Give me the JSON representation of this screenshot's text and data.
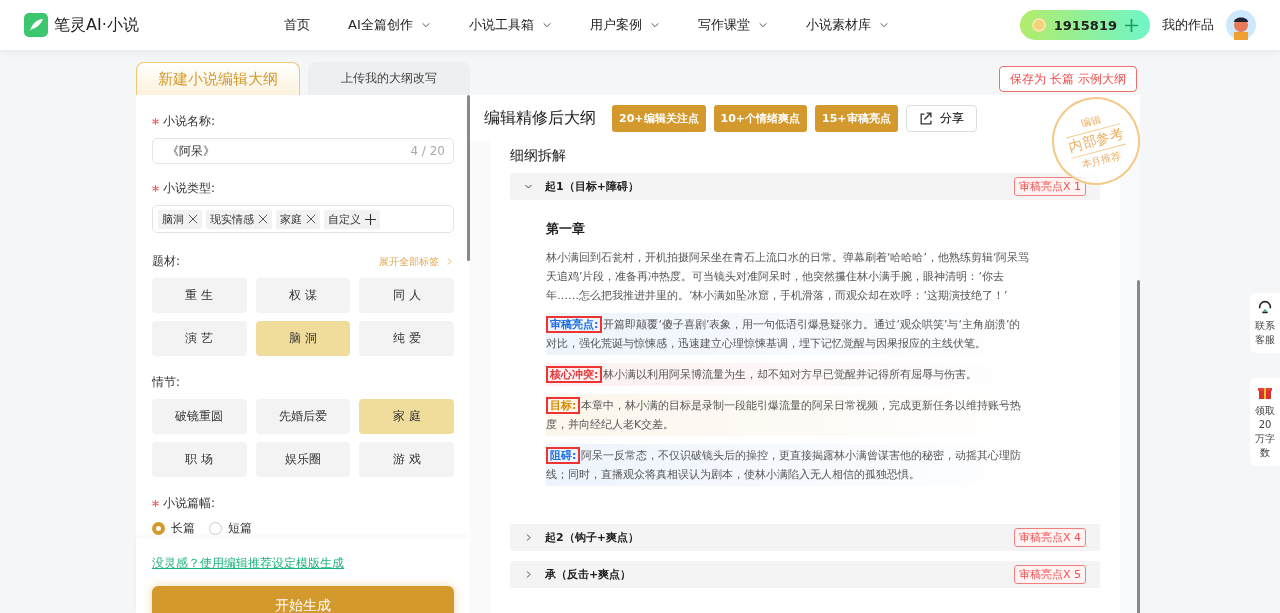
{
  "header": {
    "logo": "笔灵AI·小说",
    "nav": [
      {
        "label": "首页",
        "dropdown": false
      },
      {
        "label": "AI全篇创作",
        "dropdown": true
      },
      {
        "label": "小说工具箱",
        "dropdown": true
      },
      {
        "label": "用户案例",
        "dropdown": true
      },
      {
        "label": "写作课堂",
        "dropdown": true
      },
      {
        "label": "小说素材库",
        "dropdown": true
      }
    ],
    "credits": "1915819",
    "my_works": "我的作品"
  },
  "tabs": [
    {
      "label": "新建小说编辑大纲",
      "selected": true
    },
    {
      "label": "上传我的大纲改写",
      "selected": false
    }
  ],
  "save_button": "保存为 长篇 示例大纲",
  "form": {
    "name_label": "小说名称:",
    "name_value": "《阿呆》",
    "name_count": "4 / 20",
    "type_label": "小说类型:",
    "type_tags": [
      "脑洞",
      "现实情感",
      "家庭"
    ],
    "custom_tag": "自定义",
    "theme_label": "题材:",
    "expand_all": "展开全部标签",
    "themes": [
      {
        "label": "重 生",
        "selected": false
      },
      {
        "label": "权 谋",
        "selected": false
      },
      {
        "label": "同 人",
        "selected": false
      },
      {
        "label": "演 艺",
        "selected": false
      },
      {
        "label": "脑 洞",
        "selected": true
      },
      {
        "label": "纯 爱",
        "selected": false
      }
    ],
    "plot_label": "情节:",
    "plots": [
      {
        "label": "破镜重圆",
        "selected": false
      },
      {
        "label": "先婚后爱",
        "selected": false
      },
      {
        "label": "家 庭",
        "selected": true
      },
      {
        "label": "职 场",
        "selected": false
      },
      {
        "label": "娱乐圈",
        "selected": false
      },
      {
        "label": "游 戏",
        "selected": false
      }
    ],
    "length_label": "小说篇幅:",
    "lengths": [
      {
        "label": "长篇",
        "selected": true
      },
      {
        "label": "短篇",
        "selected": false
      }
    ],
    "template_link": "没灵感？使用编辑推荐设定模版生成",
    "generate_button": "开始生成"
  },
  "outline": {
    "title": "编辑精修后大纲",
    "badges": [
      "20+编辑关注点",
      "10+个情绪爽点",
      "15+审稿亮点"
    ],
    "share": "分享",
    "stamp": {
      "top": "编辑",
      "middle": "内部参考",
      "bottom": "本月推荐"
    },
    "section_title": "细纲拆解",
    "sections": [
      {
        "title": "起1（目标+障碍）",
        "badge": "审稿亮点X 1",
        "expanded": true,
        "chapter": "第一章",
        "summary": "林小满回到石瓮村，开机拍摄阿呆坐在青石上流口水的日常。弹幕刷着‘哈哈哈’，他熟练剪辑‘阿呆骂天追鸡’片段，准备再冲热度。可当镜头对准阿呆时，他突然攥住林小满手腕，眼神清明：‘你去年……怎么把我推进井里的。’林小满如坠冰窟，手机滑落，而观众却在欢呼：‘这期演技绝了！’",
        "notes": [
          {
            "label": "审稿亮点:",
            "text": "开篇即颠覆‘傻子喜剧’表象，用一句低语引爆悬疑张力。通过‘观众哄笑’与‘主角崩溃’的对比，强化荒诞与惊悚感，迅速建立心理惊悚基调，埋下记忆觉醒与因果报应的主线伏笔。",
            "color": "#1f6fe0"
          },
          {
            "label": "核心冲突:",
            "text": "林小满以利用阿呆博流量为生，却不知对方早已觉醒并记得所有屈辱与伤害。",
            "color": "#e0393c"
          },
          {
            "label": "目标:",
            "text": "本章中，林小满的目标是录制一段能引爆流量的阿呆日常视频，完成更新任务以维持账号热度，并向经纪人老K交差。",
            "color": "#d98a00"
          },
          {
            "label": "阻碍:",
            "text": "阿呆一反常态，不仅识破镜头后的操控，更直接揭露林小满曾谋害他的秘密，动摇其心理防线；同时，直播观众将真相误认为剧本，使林小满陷入无人相信的孤独恐惧。",
            "color": "#1f6fe0"
          }
        ]
      },
      {
        "title": "起2（钩子+爽点）",
        "badge": "审稿亮点X 4",
        "expanded": false
      },
      {
        "title": "承（反击+爽点）",
        "badge": "审稿亮点X 5",
        "expanded": false
      }
    ]
  },
  "side_widgets": [
    {
      "kind": "service",
      "label": "联系客服"
    },
    {
      "kind": "gift",
      "label": "领取20万字数"
    }
  ]
}
